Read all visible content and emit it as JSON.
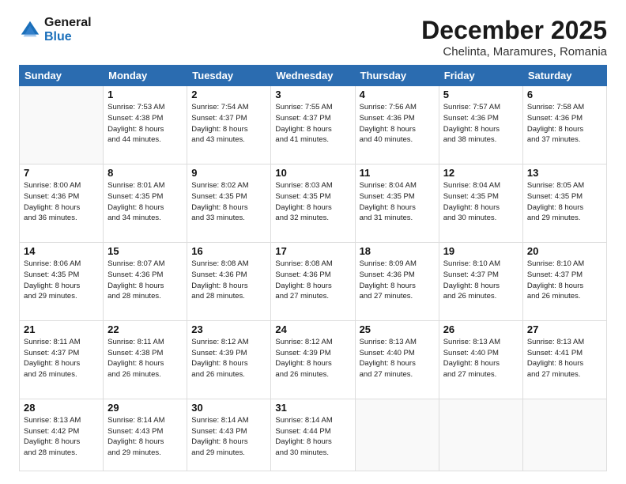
{
  "logo": {
    "line1": "General",
    "line2": "Blue"
  },
  "title": "December 2025",
  "subtitle": "Chelinta, Maramures, Romania",
  "headers": [
    "Sunday",
    "Monday",
    "Tuesday",
    "Wednesday",
    "Thursday",
    "Friday",
    "Saturday"
  ],
  "weeks": [
    [
      {
        "day": "",
        "info": ""
      },
      {
        "day": "1",
        "info": "Sunrise: 7:53 AM\nSunset: 4:38 PM\nDaylight: 8 hours\nand 44 minutes."
      },
      {
        "day": "2",
        "info": "Sunrise: 7:54 AM\nSunset: 4:37 PM\nDaylight: 8 hours\nand 43 minutes."
      },
      {
        "day": "3",
        "info": "Sunrise: 7:55 AM\nSunset: 4:37 PM\nDaylight: 8 hours\nand 41 minutes."
      },
      {
        "day": "4",
        "info": "Sunrise: 7:56 AM\nSunset: 4:36 PM\nDaylight: 8 hours\nand 40 minutes."
      },
      {
        "day": "5",
        "info": "Sunrise: 7:57 AM\nSunset: 4:36 PM\nDaylight: 8 hours\nand 38 minutes."
      },
      {
        "day": "6",
        "info": "Sunrise: 7:58 AM\nSunset: 4:36 PM\nDaylight: 8 hours\nand 37 minutes."
      }
    ],
    [
      {
        "day": "7",
        "info": "Sunrise: 8:00 AM\nSunset: 4:36 PM\nDaylight: 8 hours\nand 36 minutes."
      },
      {
        "day": "8",
        "info": "Sunrise: 8:01 AM\nSunset: 4:35 PM\nDaylight: 8 hours\nand 34 minutes."
      },
      {
        "day": "9",
        "info": "Sunrise: 8:02 AM\nSunset: 4:35 PM\nDaylight: 8 hours\nand 33 minutes."
      },
      {
        "day": "10",
        "info": "Sunrise: 8:03 AM\nSunset: 4:35 PM\nDaylight: 8 hours\nand 32 minutes."
      },
      {
        "day": "11",
        "info": "Sunrise: 8:04 AM\nSunset: 4:35 PM\nDaylight: 8 hours\nand 31 minutes."
      },
      {
        "day": "12",
        "info": "Sunrise: 8:04 AM\nSunset: 4:35 PM\nDaylight: 8 hours\nand 30 minutes."
      },
      {
        "day": "13",
        "info": "Sunrise: 8:05 AM\nSunset: 4:35 PM\nDaylight: 8 hours\nand 29 minutes."
      }
    ],
    [
      {
        "day": "14",
        "info": "Sunrise: 8:06 AM\nSunset: 4:35 PM\nDaylight: 8 hours\nand 29 minutes."
      },
      {
        "day": "15",
        "info": "Sunrise: 8:07 AM\nSunset: 4:36 PM\nDaylight: 8 hours\nand 28 minutes."
      },
      {
        "day": "16",
        "info": "Sunrise: 8:08 AM\nSunset: 4:36 PM\nDaylight: 8 hours\nand 28 minutes."
      },
      {
        "day": "17",
        "info": "Sunrise: 8:08 AM\nSunset: 4:36 PM\nDaylight: 8 hours\nand 27 minutes."
      },
      {
        "day": "18",
        "info": "Sunrise: 8:09 AM\nSunset: 4:36 PM\nDaylight: 8 hours\nand 27 minutes."
      },
      {
        "day": "19",
        "info": "Sunrise: 8:10 AM\nSunset: 4:37 PM\nDaylight: 8 hours\nand 26 minutes."
      },
      {
        "day": "20",
        "info": "Sunrise: 8:10 AM\nSunset: 4:37 PM\nDaylight: 8 hours\nand 26 minutes."
      }
    ],
    [
      {
        "day": "21",
        "info": "Sunrise: 8:11 AM\nSunset: 4:37 PM\nDaylight: 8 hours\nand 26 minutes."
      },
      {
        "day": "22",
        "info": "Sunrise: 8:11 AM\nSunset: 4:38 PM\nDaylight: 8 hours\nand 26 minutes."
      },
      {
        "day": "23",
        "info": "Sunrise: 8:12 AM\nSunset: 4:39 PM\nDaylight: 8 hours\nand 26 minutes."
      },
      {
        "day": "24",
        "info": "Sunrise: 8:12 AM\nSunset: 4:39 PM\nDaylight: 8 hours\nand 26 minutes."
      },
      {
        "day": "25",
        "info": "Sunrise: 8:13 AM\nSunset: 4:40 PM\nDaylight: 8 hours\nand 27 minutes."
      },
      {
        "day": "26",
        "info": "Sunrise: 8:13 AM\nSunset: 4:40 PM\nDaylight: 8 hours\nand 27 minutes."
      },
      {
        "day": "27",
        "info": "Sunrise: 8:13 AM\nSunset: 4:41 PM\nDaylight: 8 hours\nand 27 minutes."
      }
    ],
    [
      {
        "day": "28",
        "info": "Sunrise: 8:13 AM\nSunset: 4:42 PM\nDaylight: 8 hours\nand 28 minutes."
      },
      {
        "day": "29",
        "info": "Sunrise: 8:14 AM\nSunset: 4:43 PM\nDaylight: 8 hours\nand 29 minutes."
      },
      {
        "day": "30",
        "info": "Sunrise: 8:14 AM\nSunset: 4:43 PM\nDaylight: 8 hours\nand 29 minutes."
      },
      {
        "day": "31",
        "info": "Sunrise: 8:14 AM\nSunset: 4:44 PM\nDaylight: 8 hours\nand 30 minutes."
      },
      {
        "day": "",
        "info": ""
      },
      {
        "day": "",
        "info": ""
      },
      {
        "day": "",
        "info": ""
      }
    ]
  ]
}
